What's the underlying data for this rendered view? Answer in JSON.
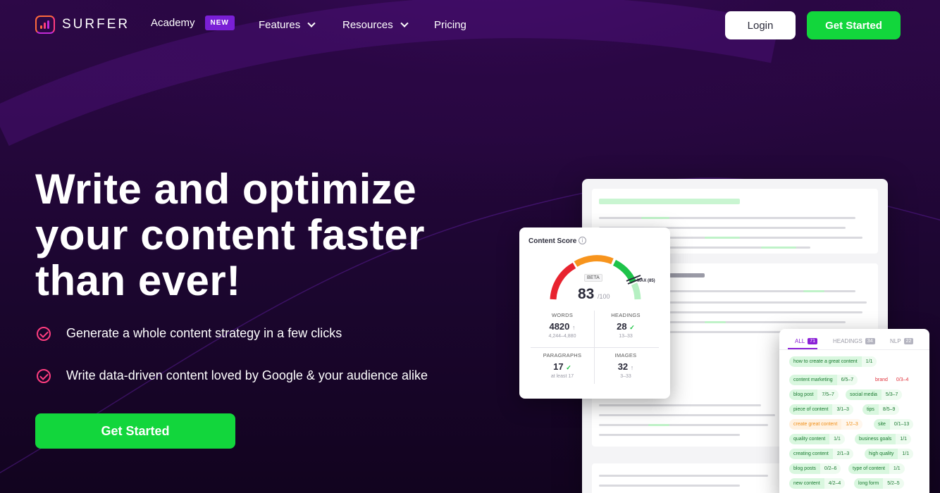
{
  "colors": {
    "background": "#1a0626",
    "accent_green": "#12d63c",
    "accent_purple": "#7a1fd6",
    "accent_pink": "#ff3d7f"
  },
  "nav": {
    "logo_text": "SURFER",
    "items": [
      {
        "label": "Academy",
        "badge": "NEW"
      },
      {
        "label": "Features",
        "dropdown": true
      },
      {
        "label": "Resources",
        "dropdown": true
      },
      {
        "label": "Pricing"
      }
    ],
    "login_label": "Login",
    "cta_label": "Get Started"
  },
  "hero": {
    "title_lines": [
      "Write and optimize",
      "your content faster",
      "than ever!"
    ],
    "bullets": [
      "Generate a whole content strategy in a few clicks",
      "Write data-driven content loved by Google & your audience alike"
    ],
    "cta_label": "Get Started"
  },
  "score_card": {
    "title": "Content Score",
    "info_icon": "i",
    "beta_label": "BETA",
    "score": "83",
    "score_max": "/100",
    "score_value": 83,
    "max_label": "MAX (85)",
    "metrics": [
      {
        "label": "WORDS",
        "value": "4820",
        "mark": "↑",
        "range": "4,244–4,880"
      },
      {
        "label": "HEADINGS",
        "value": "28",
        "mark": "✓",
        "range": "13–33"
      },
      {
        "label": "PARAGRAPHS",
        "value": "17",
        "mark": "✓",
        "range": "at least 17"
      },
      {
        "label": "IMAGES",
        "value": "32",
        "mark": "↑",
        "range": "3–33"
      }
    ]
  },
  "terms_card": {
    "tabs": [
      {
        "label": "ALL",
        "count": "71"
      },
      {
        "label": "HEADINGS",
        "count": "34"
      },
      {
        "label": "NLP",
        "count": "22"
      }
    ],
    "chips": [
      {
        "term": "how to create a great content",
        "count": "1/1",
        "status": "ok"
      },
      {
        "term": "content marketing",
        "count": "6/5–7",
        "status": "ok"
      },
      {
        "term": "brand",
        "count": "0/3–4",
        "status": "red"
      },
      {
        "term": "blog post",
        "count": "7/5–7",
        "status": "ok"
      },
      {
        "term": "social media",
        "count": "5/3–7",
        "status": "ok"
      },
      {
        "term": "piece of content",
        "count": "3/1–3",
        "status": "ok"
      },
      {
        "term": "tips",
        "count": "8/5–9",
        "status": "ok"
      },
      {
        "term": "create great content",
        "count": "1/2–3",
        "status": "orange"
      },
      {
        "term": "site",
        "count": "0/1–13",
        "status": "ok"
      },
      {
        "term": "quality content",
        "count": "1/1",
        "status": "ok"
      },
      {
        "term": "business goals",
        "count": "1/1",
        "status": "ok"
      },
      {
        "term": "creating content",
        "count": "2/1–3",
        "status": "ok"
      },
      {
        "term": "high quality",
        "count": "1/1",
        "status": "ok"
      },
      {
        "term": "blog posts",
        "count": "0/2–6",
        "status": "ok"
      },
      {
        "term": "type of content",
        "count": "1/1",
        "status": "ok"
      },
      {
        "term": "new content",
        "count": "4/2–4",
        "status": "ok"
      },
      {
        "term": "long form",
        "count": "5/2–5",
        "status": "ok"
      }
    ]
  }
}
